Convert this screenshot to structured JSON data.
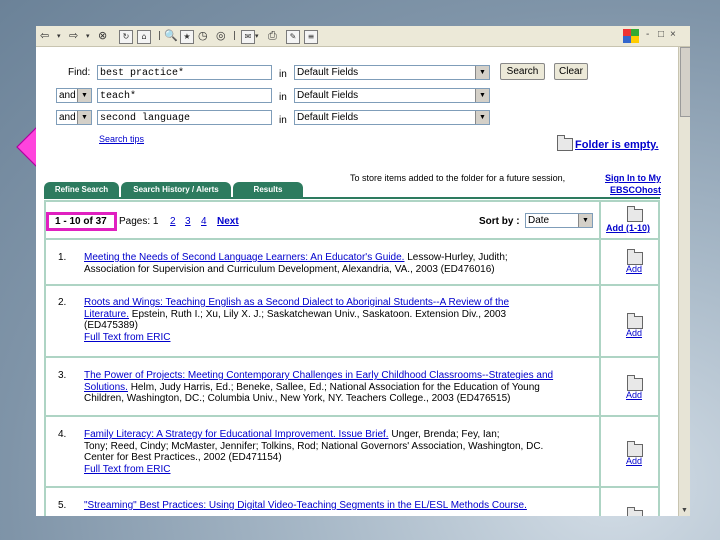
{
  "window": {
    "controls": [
      "-",
      "□",
      "×"
    ]
  },
  "search": {
    "find_label": "Find:",
    "rows": [
      {
        "operator": "",
        "term": "best practice*",
        "in_label": "in",
        "field": "Default Fields"
      },
      {
        "operator": "and",
        "term": "teach*",
        "in_label": "in",
        "field": "Default Fields"
      },
      {
        "operator": "and",
        "term": "second language",
        "in_label": "in",
        "field": "Default Fields"
      }
    ],
    "search_button": "Search",
    "clear_button": "Clear",
    "search_tips": "Search tips"
  },
  "folder": {
    "status": "Folder is empty.",
    "store_text": "To store items added to the folder for a future session,",
    "sign_in_link": "Sign In to My",
    "ebsco_link": "EBSCOhost"
  },
  "tabs": [
    {
      "label": "Refine Search"
    },
    {
      "label": "Search History / Alerts"
    },
    {
      "label": "Results"
    }
  ],
  "results_header": {
    "range": "1 - 10 of 37",
    "pages_label": "Pages: 1",
    "pages": [
      "2",
      "3",
      "4"
    ],
    "next": "Next",
    "sort_label": "Sort by :",
    "sort_value": "Date",
    "add_all": "Add (1-10)"
  },
  "results": [
    {
      "num": "1.",
      "lines": [
        {
          "link": "Meeting the Needs of Second Language Learners: An Educator's Guide.",
          "text": " Lessow-Hurley, Judith;"
        },
        {
          "link": "",
          "text": "Association for Supervision and Curriculum Development, Alexandria, VA., 2003 (ED476016)"
        }
      ],
      "add": "Add"
    },
    {
      "num": "2.",
      "lines": [
        {
          "link": "Roots and Wings: Teaching English as a Second Dialect to Aboriginal Students--A Review of the",
          "text": ""
        },
        {
          "link": "Literature.",
          "text": " Epstein, Ruth I.; Xu, Lily X. J.; Saskatchewan Univ., Saskatoon. Extension Div., 2003"
        },
        {
          "link": "",
          "text": "(ED475389)"
        },
        {
          "link": "Full Text from ERIC",
          "text": ""
        }
      ],
      "add": "Add"
    },
    {
      "num": "3.",
      "lines": [
        {
          "link": "The Power of Projects: Meeting Contemporary Challenges in Early Childhood Classrooms--Strategies and",
          "text": ""
        },
        {
          "link": "Solutions.",
          "text": " Helm, Judy Harris, Ed.; Beneke, Sallee, Ed.; National Association for the Education of Young"
        },
        {
          "link": "",
          "text": "Children, Washington, DC.; Columbia Univ., New York, NY. Teachers College., 2003 (ED476515)"
        }
      ],
      "add": "Add"
    },
    {
      "num": "4.",
      "lines": [
        {
          "link": "Family Literacy: A Strategy for Educational Improvement. Issue Brief.",
          "text": " Unger, Brenda; Fey, Ian;"
        },
        {
          "link": "",
          "text": "Tony; Reed, Cindy; McMaster, Jennifer; Tolkins, Rod; National Governors' Association, Washington, DC."
        },
        {
          "link": "",
          "text": "Center for Best Practices., 2002 (ED471154)"
        },
        {
          "link": "Full Text from ERIC",
          "text": ""
        }
      ],
      "add": "Add"
    },
    {
      "num": "5.",
      "lines": [
        {
          "link": "\"Streaming\" Best Practices: Using Digital Video-Teaching Segments in the EL/ESL Methods Course.",
          "text": ""
        }
      ],
      "add": ""
    }
  ],
  "colors": {
    "tab_green": "#2d7b5f",
    "highlight_magenta": "#e020c0",
    "link_blue": "#0000cc"
  }
}
